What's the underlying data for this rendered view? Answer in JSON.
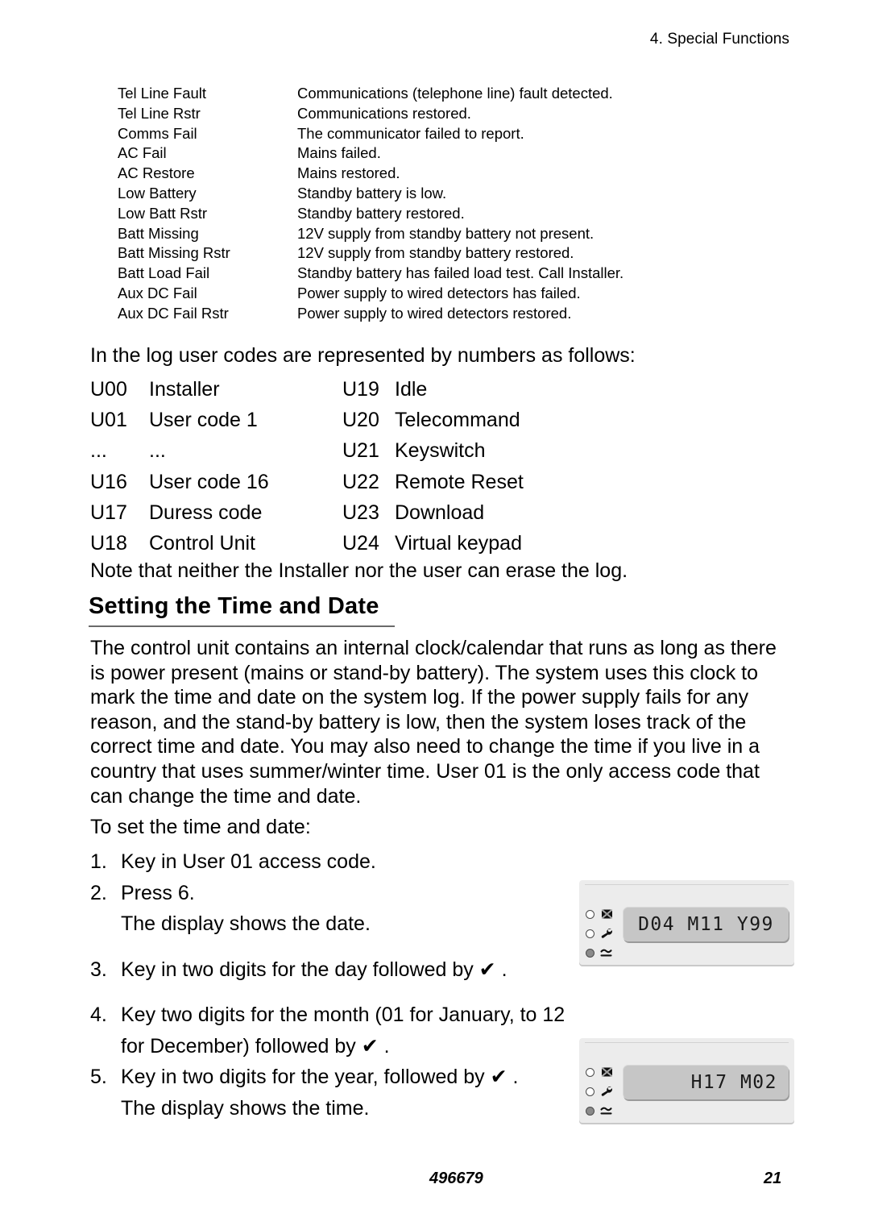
{
  "header": {
    "chapter": "4. Special Functions"
  },
  "event_table": {
    "rows": [
      {
        "name": "Tel Line Fault",
        "description": "Communications (telephone line) fault detected."
      },
      {
        "name": "Tel Line Rstr",
        "description": "Communications restored."
      },
      {
        "name": "Comms Fail",
        "description": "The communicator failed to report."
      },
      {
        "name": "AC Fail",
        "description": "Mains failed."
      },
      {
        "name": "AC Restore",
        "description": "Mains restored."
      },
      {
        "name": "Low Battery",
        "description": "Standby battery is low."
      },
      {
        "name": "Low Batt Rstr",
        "description": "Standby battery restored."
      },
      {
        "name": "Batt Missing",
        "description": "12V supply from standby battery not present."
      },
      {
        "name": "Batt Missing Rstr",
        "description": "12V supply from standby battery restored."
      },
      {
        "name": "Batt Load Fail",
        "description": "Standby battery has failed load test. Call Installer."
      },
      {
        "name": "Aux DC Fail",
        "description": "Power supply to wired detectors has failed."
      },
      {
        "name": "Aux DC Fail Rstr",
        "description": "Power supply to wired detectors restored."
      }
    ]
  },
  "user_codes": {
    "intro": "In the log user codes are represented by numbers as follows:",
    "rows": [
      {
        "left_code": "U00",
        "left_label": "Installer",
        "right_code": "U19",
        "right_label": "Idle"
      },
      {
        "left_code": "U01",
        "left_label": "User code 1",
        "right_code": "U20",
        "right_label": "Telecommand"
      },
      {
        "left_code": "...",
        "left_label": "...",
        "right_code": "U21",
        "right_label": "Keyswitch"
      },
      {
        "left_code": "U16",
        "left_label": "User code 16",
        "right_code": "U22",
        "right_label": "Remote Reset"
      },
      {
        "left_code": "U17",
        "left_label": "Duress code",
        "right_code": "U23",
        "right_label": "Download"
      },
      {
        "left_code": "U18",
        "left_label": "Control Unit",
        "right_code": "U24",
        "right_label": "Virtual keypad"
      }
    ],
    "note": "Note that neither the Installer nor the user can erase the log."
  },
  "section": {
    "heading": "Setting the Time and Date",
    "paragraph": "The control unit contains an internal clock/calendar that runs as long as there is power present (mains or stand-by battery). The system uses this clock to mark the time and date on the system log. If the power supply fails for any reason, and the stand-by battery is low, then the system loses track of the correct time and date. You may also need to change the time if you live in a country that uses summer/winter time. User 01 is the only access code that can change the time and date.",
    "lead_in": "To set the time and date:"
  },
  "steps": [
    {
      "num": "1.",
      "text": "Key in User 01 access code."
    },
    {
      "num": "2.",
      "text": "Press 6."
    },
    {
      "num": "3.",
      "text": "Key in two digits for the day followed by ✔ ."
    },
    {
      "num": "4.",
      "text": "Key two digits for the month (01 for January, to 12 for December) followed by ✔ ."
    },
    {
      "num": "5.",
      "text": "Key in two digits for the year, followed by ✔ ."
    }
  ],
  "substeps": {
    "after_step2": "The display shows the date.",
    "after_step5": "The display shows the time."
  },
  "keypads": [
    {
      "lcd_text": "D04 M11 Y99",
      "lcd_align": "center",
      "leds": [
        {
          "icon": "tamper-crossed-box-icon",
          "state": "off"
        },
        {
          "icon": "wrench-service-icon",
          "state": "off"
        },
        {
          "icon": "mains-power-icon",
          "state": "on"
        }
      ]
    },
    {
      "lcd_text": "H17 M02",
      "lcd_align": "right",
      "leds": [
        {
          "icon": "tamper-crossed-box-icon",
          "state": "off"
        },
        {
          "icon": "wrench-service-icon",
          "state": "off"
        },
        {
          "icon": "mains-power-icon",
          "state": "on"
        }
      ]
    }
  ],
  "footer": {
    "doc_code": "496679",
    "page_number": "21"
  },
  "colors": {
    "text": "#000000",
    "rule": "#6a6a6a",
    "keypad_body": "#ececec",
    "lcd_face": "#c6c6c6",
    "led_on": "#8a8a8a"
  }
}
